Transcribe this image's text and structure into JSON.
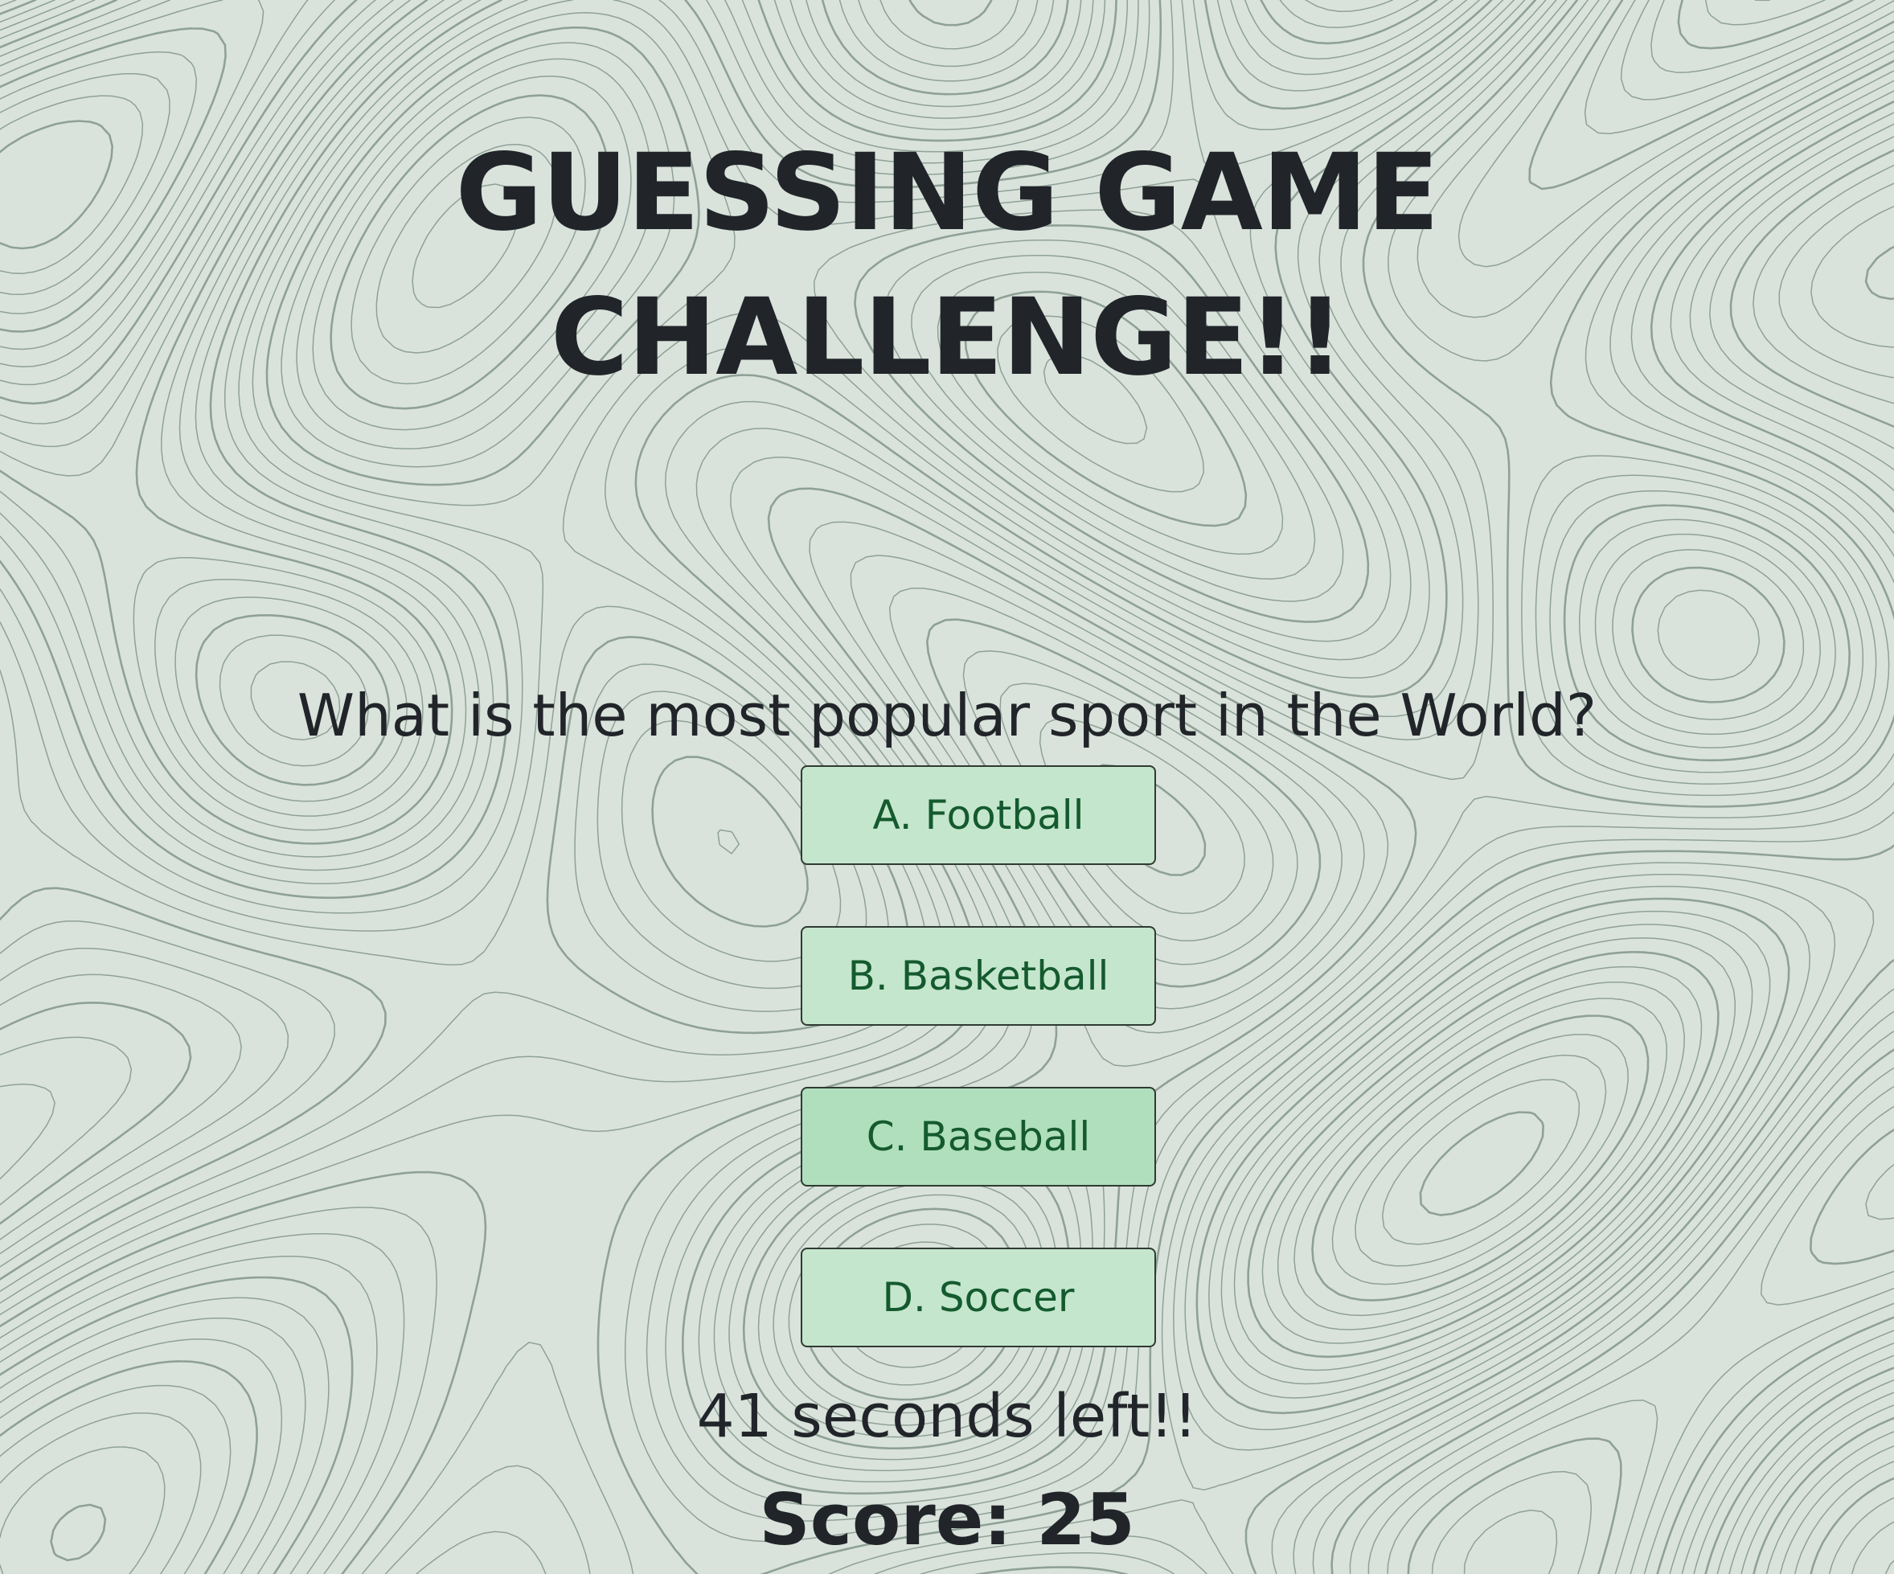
{
  "game": {
    "title_line1": "GUESSING GAME",
    "title_line2": "CHALLENGE!!",
    "question": "What is the most popular sport in the World?",
    "answers": [
      {
        "label": "A. Football"
      },
      {
        "label": "B. Basketball"
      },
      {
        "label": "C. Baseball"
      },
      {
        "label": "D. Soccer"
      }
    ],
    "timer_text": "41 seconds left!!",
    "score_text": "Score: 25",
    "time_left_seconds": 41,
    "score": 25
  },
  "colors": {
    "background": "#d9e3dc",
    "contour_line": "#8fa196",
    "text": "#212529",
    "button_fill": "#c4e6cd",
    "button_fill_hover": "#b0dfbd",
    "button_text": "#145a2e"
  }
}
